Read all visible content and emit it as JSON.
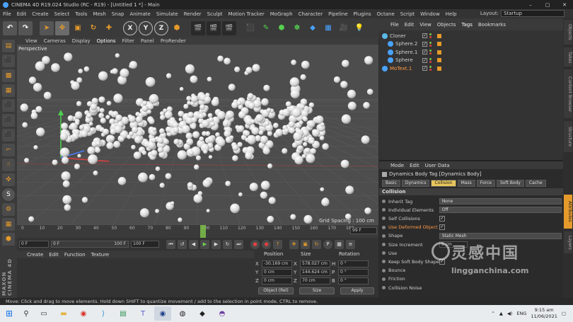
{
  "window": {
    "title": "CINEMA 4D R19.024 Studio (RC - R19) - [Untitled 1 *] - Main"
  },
  "menubar": {
    "items": [
      "File",
      "Edit",
      "Create",
      "Select",
      "Tools",
      "Mesh",
      "Snap",
      "Animate",
      "Simulate",
      "Render",
      "Sculpt",
      "Motion Tracker",
      "MoGraph",
      "Character",
      "Pipeline",
      "Plugins",
      "Octane",
      "Script",
      "Window",
      "Help"
    ],
    "layout_label": "Layout:",
    "layout_value": "Startup"
  },
  "toolbar": {
    "axis_labels": [
      "X",
      "Y",
      "Z"
    ]
  },
  "viewport": {
    "menu": [
      "View",
      "Cameras",
      "Display",
      "Options",
      "Filter",
      "Panel",
      "ProRender"
    ],
    "active_menu": "Options",
    "label": "Perspective",
    "grid_spacing": "Grid Spacing : 100 cm"
  },
  "timeline": {
    "ticks": [
      "0",
      "10",
      "20",
      "30",
      "40",
      "50",
      "60",
      "70",
      "80",
      "90",
      "100",
      "110",
      "120",
      "130",
      "140",
      "150",
      "160",
      "170",
      "180"
    ],
    "current_frame": "90",
    "end_field": "99 F"
  },
  "playback": {
    "start": "0 F",
    "current": "0 F",
    "preview_end": "100 F",
    "end": "100 F"
  },
  "materials": {
    "menu": [
      "Create",
      "Edit",
      "Function",
      "Texture"
    ]
  },
  "coordinates": {
    "headers": {
      "position": "Position",
      "size": "Size",
      "rotation": "Rotation"
    },
    "rows": [
      {
        "axis": "X",
        "position": "-30.169 cm",
        "size": "578.027 cm",
        "rot_label": "H",
        "rotation": "0 °"
      },
      {
        "axis": "Y",
        "position": "0 cm",
        "size": "144.624 cm",
        "rot_label": "P",
        "rotation": "0 °"
      },
      {
        "axis": "Z",
        "position": "0 cm",
        "size": "70 cm",
        "rot_label": "B",
        "rotation": "0 °"
      }
    ],
    "mode_dropdown": "Object (Rel)",
    "size_dropdown": "Size",
    "apply_label": "Apply"
  },
  "object_manager": {
    "menu": [
      "File",
      "Edit",
      "View",
      "Objects",
      "Tags",
      "Bookmarks"
    ],
    "active_menu": "Tags",
    "objects": [
      {
        "name": "Cloner",
        "indent": 0,
        "color": "#59b8e8",
        "active": false
      },
      {
        "name": "Sphere.2",
        "indent": 1,
        "color": "#4aa3ff",
        "active": false
      },
      {
        "name": "Sphere.1",
        "indent": 1,
        "color": "#4aa3ff",
        "active": false
      },
      {
        "name": "Sphere",
        "indent": 1,
        "color": "#4aa3ff",
        "active": false
      },
      {
        "name": "MoText.1",
        "indent": 0,
        "color": "#4aa3ff",
        "active": true
      }
    ]
  },
  "attributes": {
    "menu": [
      "Mode",
      "Edit",
      "User Data"
    ],
    "title": "Dynamics Body Tag [Dynamics Body]",
    "tabs": [
      "Basic",
      "Dynamics",
      "Collision",
      "Mass",
      "Force",
      "Soft Body",
      "Cache"
    ],
    "active_tab": "Collision",
    "section": "Collision",
    "rows": [
      {
        "label": "Inherit Tag",
        "type": "dropdown",
        "value": "None",
        "hl": false
      },
      {
        "label": "Individual Elements",
        "type": "dropdown",
        "value": "Off",
        "hl": false
      },
      {
        "label": "Self Collisions",
        "type": "check",
        "value": "✓",
        "hl": false
      },
      {
        "label": "Use Deformed Object",
        "type": "check",
        "value": "✓",
        "hl": true
      },
      {
        "label": "Shape",
        "type": "dropdown",
        "value": "Static Mesh",
        "hl": false
      },
      {
        "label": "Size Increment",
        "type": "number",
        "value": "0 cm",
        "hl": false
      },
      {
        "label": "Use",
        "type": "none",
        "value": "",
        "hl": false
      },
      {
        "label": "Keep Soft Body Shape",
        "type": "check",
        "value": "✓",
        "hl": false
      },
      {
        "label": "Bounce",
        "type": "none",
        "value": "",
        "hl": false
      },
      {
        "label": "Friction",
        "type": "none",
        "value": "",
        "hl": false
      },
      {
        "label": "Collision Noise",
        "type": "none",
        "value": "",
        "hl": false
      }
    ]
  },
  "right_tabs": [
    "Objects",
    "Takes",
    "Content Browser",
    "Structure",
    "Attributes",
    "Layers"
  ],
  "status": {
    "text": "Move: Click and drag to move elements. Hold down SHIFT to quantize movement / add to the selection in point mode, CTRL to remove."
  },
  "taskbar": {
    "time": "9:15 am",
    "date": "11/06/2021",
    "lang": "ENG"
  },
  "watermark": {
    "cn": "灵感中国",
    "en": "lingganchina.com"
  }
}
